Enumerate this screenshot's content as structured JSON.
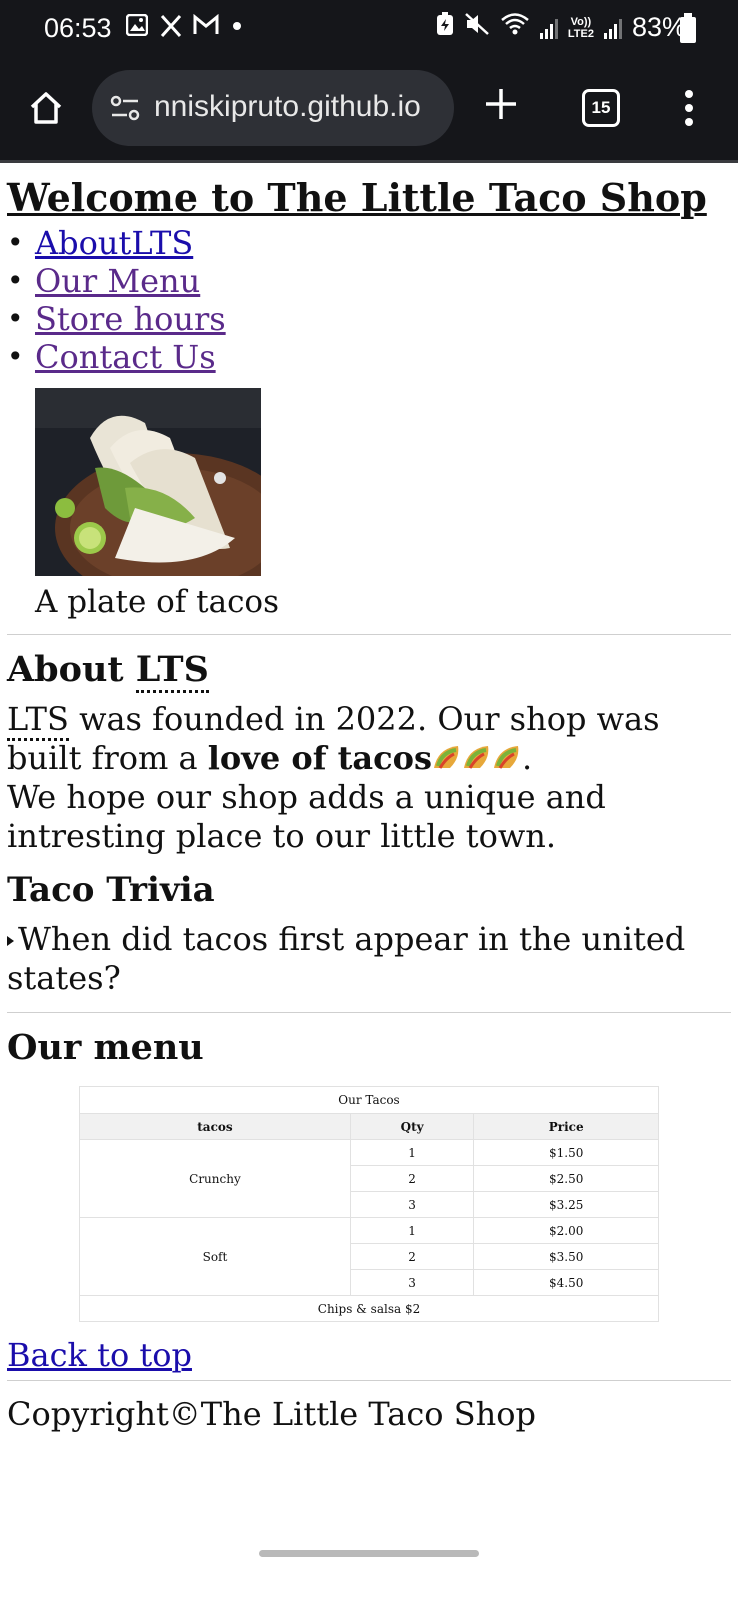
{
  "status_bar": {
    "time": "06:53",
    "lte_label_top": "Vo))",
    "lte_label_bottom": "LTE2",
    "battery": "83%"
  },
  "browser": {
    "url": "nniskipruto.github.io",
    "tab_count": "15"
  },
  "page": {
    "title": "Welcome to The Little Taco Shop",
    "nav": [
      {
        "label": "AboutLTS"
      },
      {
        "label": "Our Menu"
      },
      {
        "label": "Store hours"
      },
      {
        "label": "Contact Us"
      }
    ],
    "image_caption": "A plate of tacos",
    "about": {
      "heading_prefix": "About ",
      "heading_abbr": "LTS",
      "p1_abbr": "LTS",
      "p1_text": " was founded in 2022. Our shop was built from a ",
      "p1_bold": "love of tacos",
      "p1_end": ".",
      "p2": "We hope our shop adds a unique and intresting place to our little town."
    },
    "trivia": {
      "heading": "Taco Trivia",
      "question": "When did tacos first appear in the united states?"
    },
    "menu": {
      "heading": "Our menu",
      "caption": "Our Tacos",
      "headers": [
        "tacos",
        "Qty",
        "Price"
      ],
      "groups": [
        {
          "name": "Crunchy",
          "rows": [
            {
              "qty": "1",
              "price": "$1.50"
            },
            {
              "qty": "2",
              "price": "$2.50"
            },
            {
              "qty": "3",
              "price": "$3.25"
            }
          ]
        },
        {
          "name": "Soft",
          "rows": [
            {
              "qty": "1",
              "price": "$2.00"
            },
            {
              "qty": "2",
              "price": "$3.50"
            },
            {
              "qty": "3",
              "price": "$4.50"
            }
          ]
        }
      ],
      "footer": "Chips & salsa $2"
    },
    "back_to_top": "Back to top",
    "copyright": "Copyright©The Little Taco Shop"
  }
}
